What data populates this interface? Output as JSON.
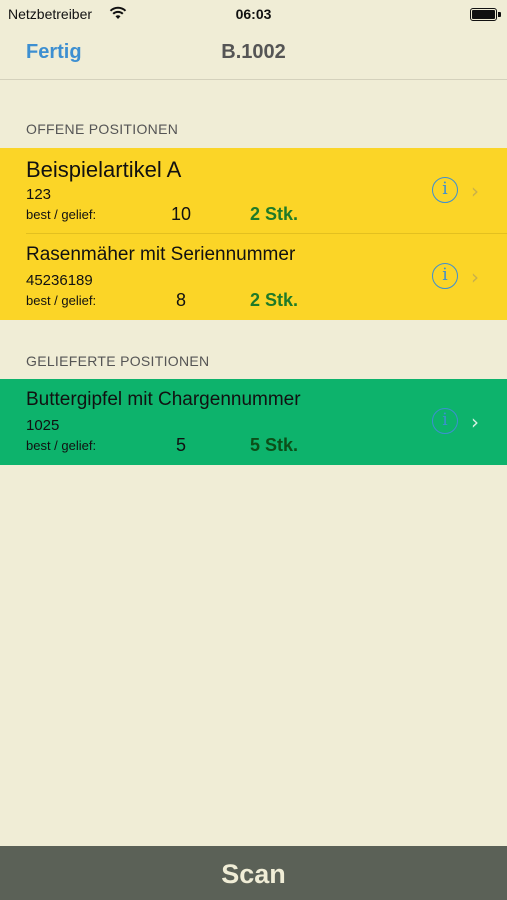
{
  "status_bar": {
    "carrier": "Netzbetreiber",
    "time": "06:03"
  },
  "nav": {
    "done_label": "Fertig",
    "title": "B.1002"
  },
  "sections": {
    "open_header": "OFFENE POSITIONEN",
    "delivered_header": "GELIEFERTE POSITIONEN"
  },
  "open_items": [
    {
      "name": "Beispielartikel A",
      "number": "123",
      "label": "best / gelief:",
      "ordered": "10",
      "delivered": "2 Stk."
    },
    {
      "name": "Rasenmäher mit Seriennummer",
      "number": "45236189",
      "label": "best / gelief:",
      "ordered": "8",
      "delivered": "2 Stk."
    }
  ],
  "delivered_items": [
    {
      "name": "Buttergipfel mit Chargennummer",
      "number": "1025",
      "label": "best / gelief:",
      "ordered": "5",
      "delivered": "5 Stk."
    }
  ],
  "scan": {
    "label": "Scan"
  },
  "colors": {
    "background": "#f0edd6",
    "open_row": "#fbd527",
    "delivered_row": "#0db36c",
    "accent": "#3d8fd1",
    "scan_bar": "#5b6157"
  },
  "icons": {
    "info": "info-icon",
    "chevron": "chevron-right-icon",
    "wifi": "wifi-icon",
    "battery": "battery-icon"
  }
}
